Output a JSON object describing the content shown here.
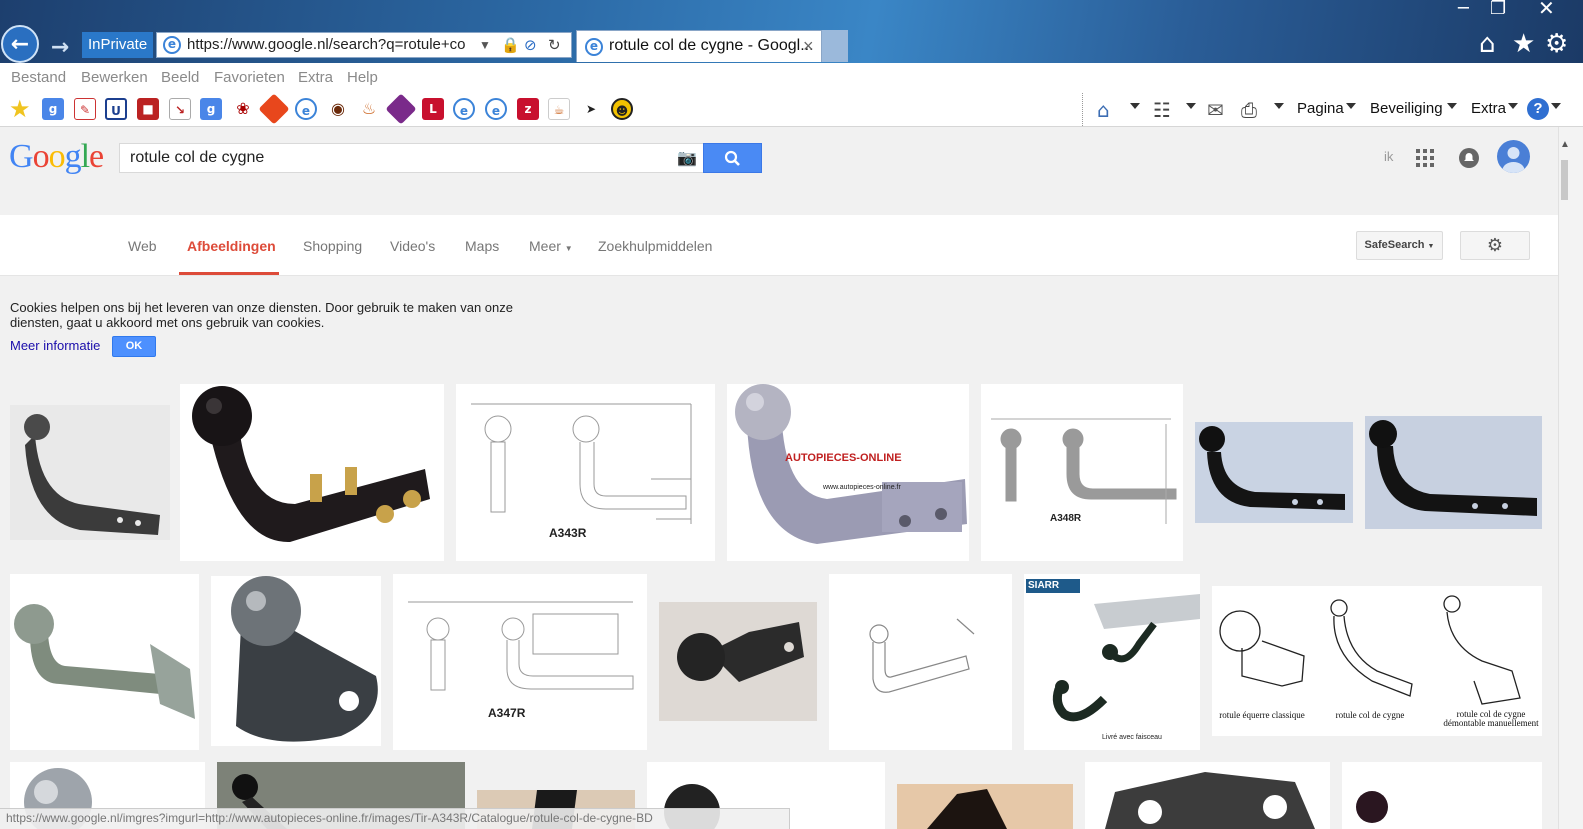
{
  "browser": {
    "inprivate_label": "InPrivate",
    "url": "https://www.google.nl/search?q=rotule+co",
    "tab_title": "rotule col de cygne - Googl...",
    "tab_close": "×",
    "window_controls": [
      "minimize-icon",
      "maximize-icon",
      "close-icon"
    ],
    "toolbar_icons": [
      "home-icon",
      "star-icon",
      "gear-icon"
    ]
  },
  "menubar": {
    "items": [
      "Bestand",
      "Bewerken",
      "Beeld",
      "Favorieten",
      "Extra",
      "Help"
    ]
  },
  "command_bar": {
    "pagina": "Pagina",
    "beveiliging": "Beveiliging",
    "extra": "Extra",
    "help": "?"
  },
  "google": {
    "logo": "Google",
    "query": "rotule col de cygne",
    "account_label": "ik",
    "colors": {
      "blue": "#4285f4",
      "red": "#ea4335",
      "yellow": "#fbbc05",
      "green": "#34a853",
      "accent": "#dd4b39"
    }
  },
  "nav": {
    "tabs": [
      "Web",
      "Afbeeldingen",
      "Shopping",
      "Video's",
      "Maps",
      "Meer",
      "Zoekhulpmiddelen"
    ],
    "active": "Afbeeldingen",
    "safesearch": "SafeSearch"
  },
  "cookie": {
    "text": "Cookies helpen ons bij het leveren van onze diensten. Door gebruik te maken van onze diensten, gaat u akkoord met ons gebruik van cookies.",
    "more": "Meer informatie",
    "ok": "OK"
  },
  "images": {
    "label_a343r": "A343R",
    "label_a348r": "A348R",
    "label_a347r": "A347R",
    "autopieces_brand": "AUTOPIECES-ONLINE",
    "autopieces_url": "www.autopieces-online.fr",
    "siarr_brand": "SIARR",
    "siarr_caption": "Livré avec faisceau",
    "caption_equerre": "rotule équerre classique",
    "caption_col": "rotule col de cygne",
    "caption_demontable": "rotule col de cygne démontable manuellement"
  },
  "status_bar": {
    "text": "https://www.google.nl/imgres?imgurl=http://www.autopieces-online.fr/images/Tir-A343R/Catalogue/rotule-col-de-cygne-BD"
  }
}
